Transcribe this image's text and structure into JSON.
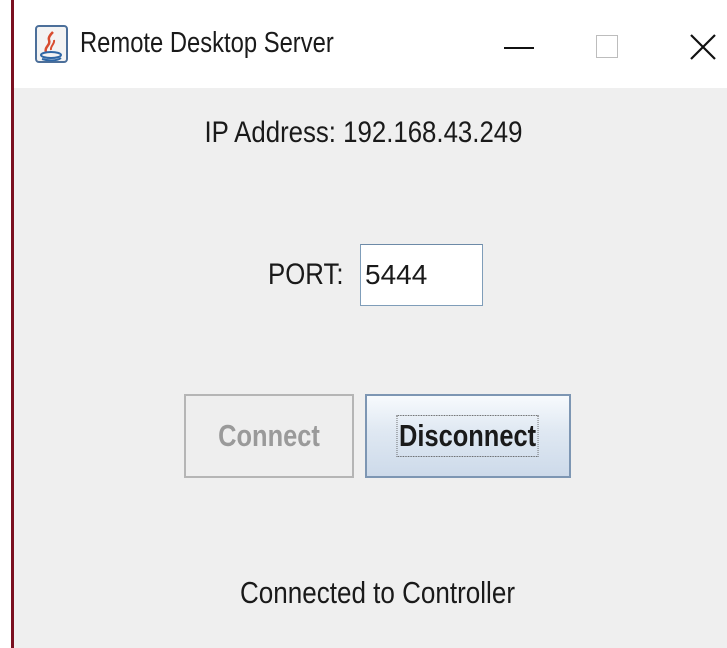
{
  "window": {
    "title": "Remote Desktop Server",
    "app_icon": "java-icon",
    "controls": [
      "minimize-icon",
      "maximize-icon",
      "close-icon"
    ]
  },
  "server": {
    "ip_address_text": "IP Address: 192.168.43.249",
    "port_label": "PORT:",
    "port_value": "5444"
  },
  "buttons": {
    "connect_label": "Connect",
    "connect_enabled": false,
    "disconnect_label": "Disconnect",
    "disconnect_enabled": true
  },
  "status": {
    "text": "Connected to Controller"
  },
  "colors": {
    "window_background": "#efefef",
    "titlebar_background": "#ffffff",
    "disabled_text": "#9a9a9a",
    "active_button_border": "#7d96b3"
  }
}
